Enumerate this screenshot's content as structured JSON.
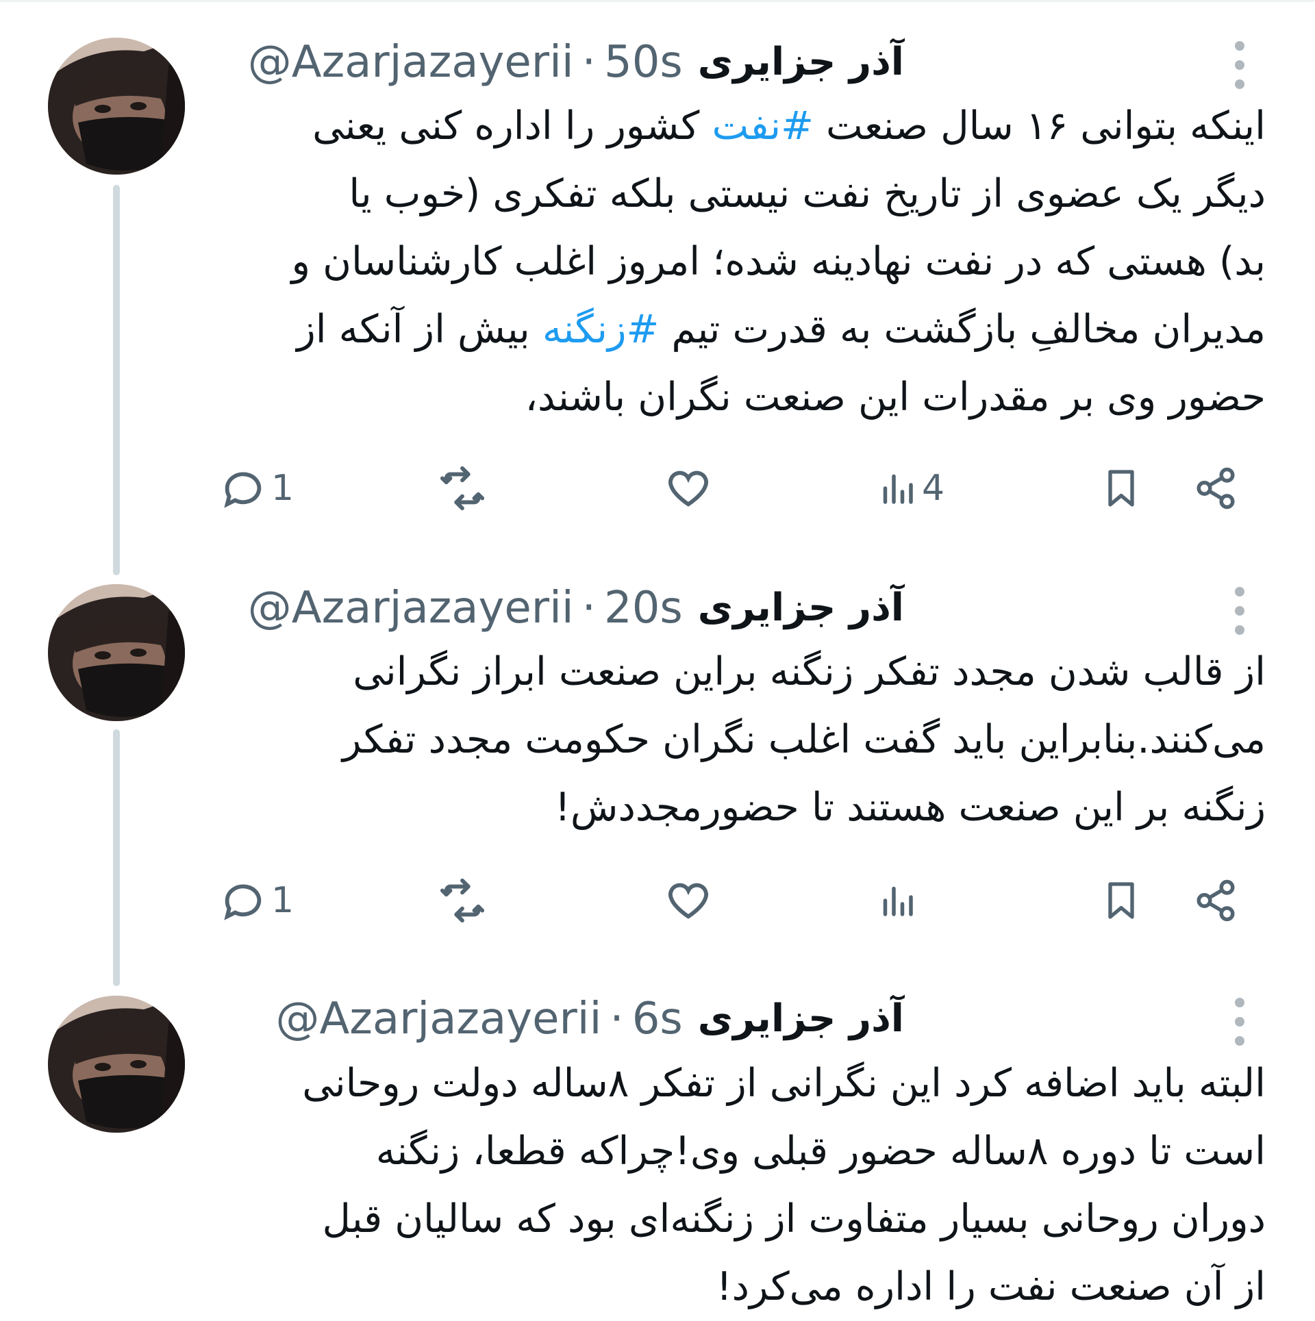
{
  "thread": [
    {
      "author_name": "آذر جزایری",
      "handle": "@Azarjazayerii",
      "separator": "·",
      "time": "50s",
      "lines": [
        [
          {
            "text": "اینکه بتوانی ۱۶ سال صنعت "
          },
          {
            "text": "#نفت",
            "hashtag": true
          },
          {
            "text": " کشور را اداره کنی یعنی"
          }
        ],
        [
          {
            "text": "دیگر یک عضوی از تاریخ نفت نیستی بلکه تفکری (خوب یا"
          }
        ],
        [
          {
            "text": "بد) هستی که در نفت نهادینه شده؛ امروز اغلب کارشناسان و"
          }
        ],
        [
          {
            "text": "مدیران مخالفِ بازگشت به قدرت تیم "
          },
          {
            "text": "#زنگنه",
            "hashtag": true
          },
          {
            "text": " بیش از آنکه از"
          }
        ],
        [
          {
            "text": "حضور وی بر مقدرات این صنعت نگران باشند،"
          }
        ]
      ],
      "actions": {
        "replies": "1",
        "retweets": "",
        "likes": "",
        "views": "4"
      }
    },
    {
      "author_name": "آذر جزایری",
      "handle": "@Azarjazayerii",
      "separator": "·",
      "time": "20s",
      "lines": [
        [
          {
            "text": "از قالب شدن مجدد تفکر زنگنه براین صنعت ابراز نگرانی"
          }
        ],
        [
          {
            "text": "می‌کنند.بنابراین باید گفت اغلب نگران حکومت مجدد تفکر"
          }
        ],
        [
          {
            "text": "زنگنه بر این صنعت هستند تا حضورمجددش!"
          }
        ]
      ],
      "actions": {
        "replies": "1",
        "retweets": "",
        "likes": "",
        "views": ""
      }
    },
    {
      "author_name": "آذر جزایری",
      "handle": "@Azarjazayerii",
      "separator": "·",
      "time": "6s",
      "lines": [
        [
          {
            "text": "البته باید اضافه کرد این نگرانی از تفکر ۸ساله دولت روحانی"
          }
        ],
        [
          {
            "text": "است تا دوره ۸ساله حضور قبلی وی!چراکه قطعا، زنگنه"
          }
        ],
        [
          {
            "text": "دوران روحانی بسیار متفاوت از زنگنه‌ای بود که سالیان قبل"
          }
        ],
        [
          {
            "text": "از آن صنعت نفت را اداره می‌کرد!"
          }
        ]
      ],
      "actions": null
    }
  ],
  "colors": {
    "text": "#0f1419",
    "secondary": "#536471",
    "hashtag": "#1d9bf0",
    "thread_line": "#cfd9de"
  },
  "icons": {
    "reply": "reply-icon",
    "retweet": "retweet-icon",
    "like": "heart-icon",
    "views": "views-icon",
    "bookmark": "bookmark-icon",
    "share": "share-icon",
    "more": "more-vertical-icon"
  }
}
